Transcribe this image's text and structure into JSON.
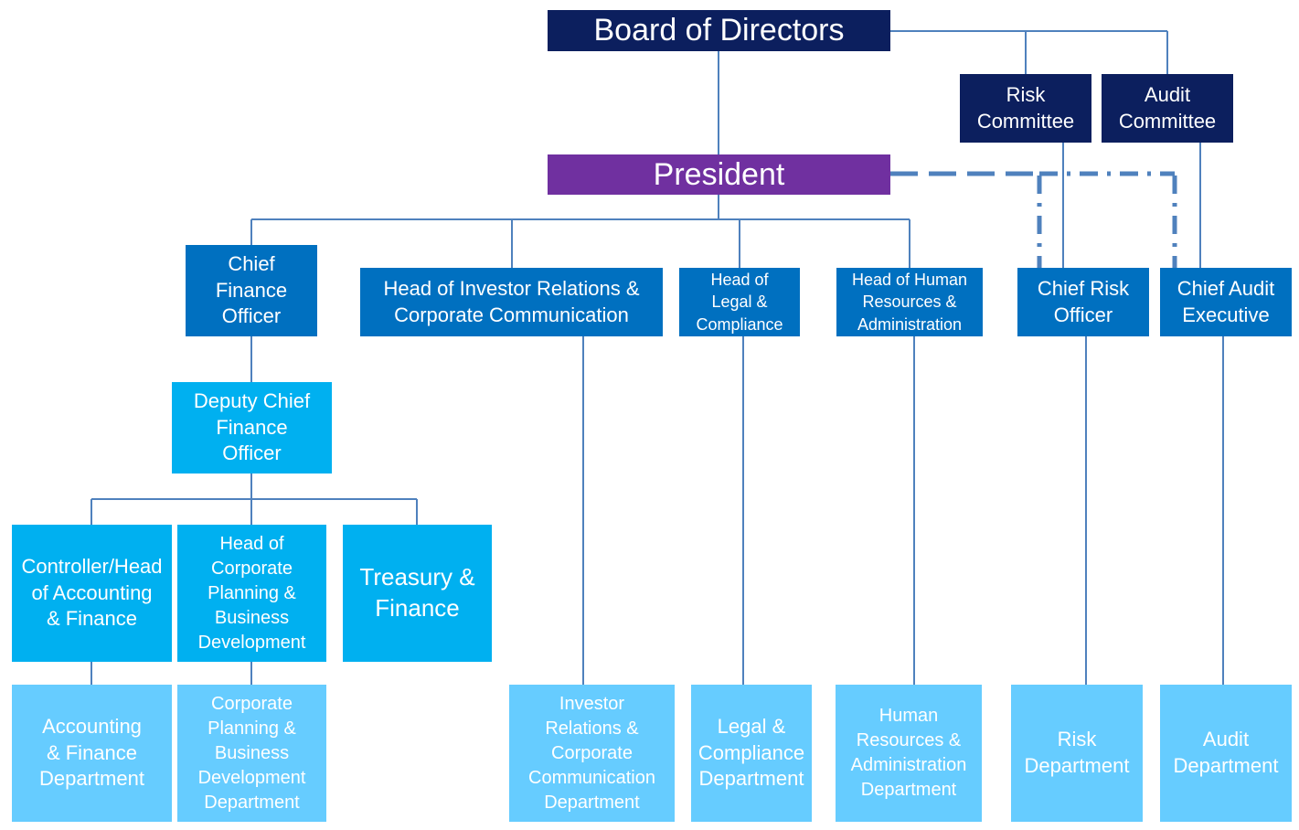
{
  "colors": {
    "board": "#0c1f5e",
    "president": "#7030a0",
    "executive": "#0070c0",
    "finance_unit": "#00b0f0",
    "department": "#66ccff",
    "connector": "#4f81bd"
  },
  "nodes": {
    "board": "Board of Directors",
    "risk_committee": "Risk\nCommittee",
    "audit_committee": "Audit\nCommittee",
    "president": "President",
    "cfo": "Chief\nFinance\nOfficer",
    "head_ir": "Head of Investor Relations  &\nCorporate Communication",
    "head_legal": "Head of\nLegal &\nCompliance",
    "head_hr": "Head of  Human\nResources &\nAdministration",
    "cro": "Chief Risk\nOfficer",
    "cae": "Chief Audit\nExecutive",
    "deputy_cfo": "Deputy Chief\nFinance\nOfficer",
    "controller": "Controller/Head\nof Accounting\n& Finance",
    "head_corp_planning": "Head of\nCorporate\nPlanning &\nBusiness\nDevelopment",
    "treasury": "Treasury &\nFinance",
    "dept_accounting": "Accounting\n& Finance\nDepartment",
    "dept_corp_planning": "Corporate\nPlanning &\nBusiness\nDevelopment\nDepartment",
    "dept_ir": "Investor\nRelations &\nCorporate\nCommunication\nDepartment",
    "dept_legal": "Legal &\nCompliance\nDepartment",
    "dept_hr": "Human\nResources &\nAdministration\nDepartment",
    "dept_risk": "Risk\nDepartment",
    "dept_audit": "Audit\nDepartment"
  }
}
